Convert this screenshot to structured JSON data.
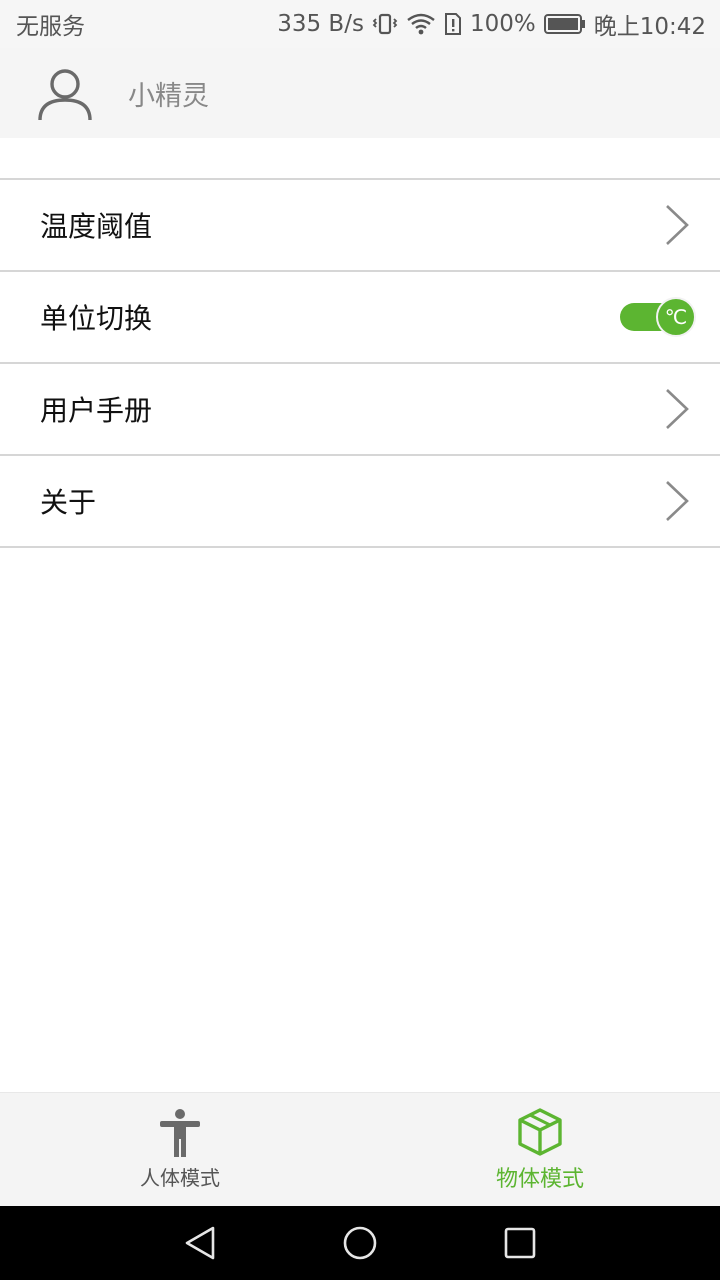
{
  "status_bar": {
    "carrier": "无服务",
    "net_speed": "335 B/s",
    "battery": "100%",
    "time": "晚上10:42"
  },
  "profile": {
    "name": "小精灵",
    "icon": "user-avatar-icon"
  },
  "settings": {
    "items": [
      {
        "label": "温度阈值",
        "control": "chevron"
      },
      {
        "label": "单位切换",
        "control": "toggle",
        "toggle_text": "℃",
        "toggle_on": true
      },
      {
        "label": "用户手册",
        "control": "chevron"
      },
      {
        "label": "关于",
        "control": "chevron"
      }
    ]
  },
  "tabs": [
    {
      "label": "人体模式",
      "icon": "person-icon",
      "active": false
    },
    {
      "label": "物体模式",
      "icon": "cube-icon",
      "active": true
    }
  ],
  "colors": {
    "accent": "#5cb531",
    "divider": "#d6d6d6",
    "header_bg": "#f5f5f5"
  }
}
